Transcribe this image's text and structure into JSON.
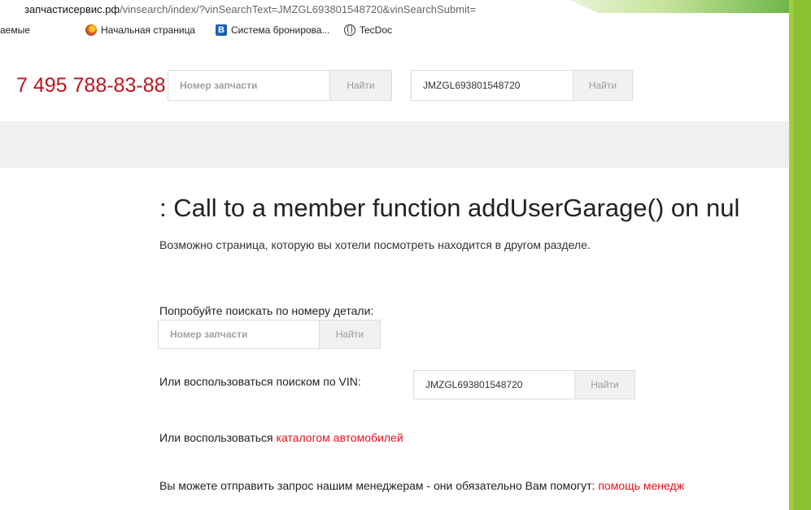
{
  "browser": {
    "url_domain": "запчастисервис.рф",
    "url_path": "/vinsearch/index/?vinSearchText=JMZGL693801548720&vinSearchSubmit=",
    "bookmarks": [
      {
        "label": "аемые",
        "icon": "none"
      },
      {
        "label": "Начальная страница",
        "icon": "firefox-icon"
      },
      {
        "label": "Система бронирова...",
        "icon": "booking-b-icon"
      },
      {
        "label": "TecDoc",
        "icon": "globe-icon"
      }
    ]
  },
  "header": {
    "phone": "7 495 788-83-88",
    "part_search": {
      "placeholder": "Номер запчасти",
      "button": "Найти"
    },
    "vin_search": {
      "value": "JMZGL693801548720",
      "button": "Найти"
    }
  },
  "error": {
    "title": ": Call to a member function addUserGarage() on nul",
    "subtitle": "Возможно страница, которую вы хотели посмотреть находится в другом разделе."
  },
  "help": {
    "part_prompt": "Попробуйте поискать по номеру детали:",
    "part_search": {
      "placeholder": "Номер запчасти",
      "button": "Найти"
    },
    "vin_prompt": "Или воспользоваться поиском по VIN:",
    "vin_search": {
      "value": "JMZGL693801548720",
      "button": "Найти"
    },
    "catalog_prefix": "Или воспользоваться ",
    "catalog_link": "каталогом автомобилей",
    "manager_prefix": "Вы можете отправить запрос нашим менеджерам - они обязательно Вам помогут: ",
    "manager_link": "помощь менедж"
  },
  "colors": {
    "accent_red": "#e0101a",
    "phone_red": "#c1121f",
    "slide_green": "#9fcf3a"
  }
}
